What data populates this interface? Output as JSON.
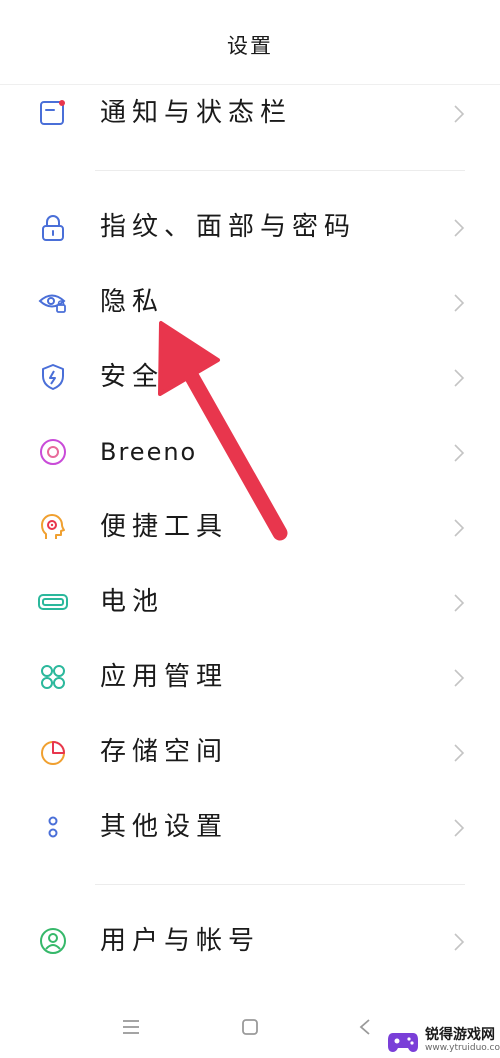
{
  "header": {
    "title": "设置"
  },
  "items": [
    {
      "label": "通知与状态栏"
    },
    {
      "label": "指纹、面部与密码"
    },
    {
      "label": "隐私"
    },
    {
      "label": "安全"
    },
    {
      "label": "Breeno"
    },
    {
      "label": "便捷工具"
    },
    {
      "label": "电池"
    },
    {
      "label": "应用管理"
    },
    {
      "label": "存储空间"
    },
    {
      "label": "其他设置"
    },
    {
      "label": "用户与帐号"
    }
  ],
  "colors": {
    "blue": "#4a6fd8",
    "purple": "#c94bd8",
    "orange": "#f0a030",
    "green": "#2bb89c",
    "lime": "#36b86a",
    "arrow": "#e8364d"
  },
  "watermark": {
    "line1": "锐得游戏网",
    "line2": "www.ytruiduo.com"
  }
}
